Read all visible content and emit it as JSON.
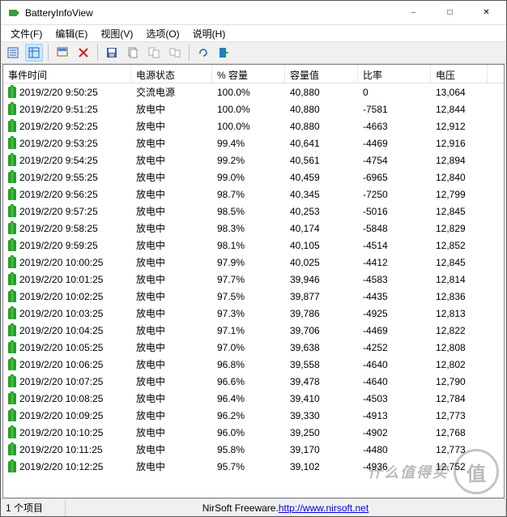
{
  "window": {
    "title": "BatteryInfoView"
  },
  "menu": {
    "file": "文件(F)",
    "edit": "编辑(E)",
    "view": "视图(V)",
    "options": "选项(O)",
    "help": "说明(H)"
  },
  "columns": {
    "time": "事件时间",
    "state": "电源状态",
    "pct": "% 容量",
    "cap": "容量值",
    "rate": "比率",
    "voltage": "电压"
  },
  "rows": [
    {
      "time": "2019/2/20 9:50:25",
      "state": "交流电源",
      "pct": "100.0%",
      "cap": "40,880",
      "rate": "0",
      "voltage": "13,064"
    },
    {
      "time": "2019/2/20 9:51:25",
      "state": "放电中",
      "pct": "100.0%",
      "cap": "40,880",
      "rate": "-7581",
      "voltage": "12,844"
    },
    {
      "time": "2019/2/20 9:52:25",
      "state": "放电中",
      "pct": "100.0%",
      "cap": "40,880",
      "rate": "-4663",
      "voltage": "12,912"
    },
    {
      "time": "2019/2/20 9:53:25",
      "state": "放电中",
      "pct": "99.4%",
      "cap": "40,641",
      "rate": "-4469",
      "voltage": "12,916"
    },
    {
      "time": "2019/2/20 9:54:25",
      "state": "放电中",
      "pct": "99.2%",
      "cap": "40,561",
      "rate": "-4754",
      "voltage": "12,894"
    },
    {
      "time": "2019/2/20 9:55:25",
      "state": "放电中",
      "pct": "99.0%",
      "cap": "40,459",
      "rate": "-6965",
      "voltage": "12,840"
    },
    {
      "time": "2019/2/20 9:56:25",
      "state": "放电中",
      "pct": "98.7%",
      "cap": "40,345",
      "rate": "-7250",
      "voltage": "12,799"
    },
    {
      "time": "2019/2/20 9:57:25",
      "state": "放电中",
      "pct": "98.5%",
      "cap": "40,253",
      "rate": "-5016",
      "voltage": "12,845"
    },
    {
      "time": "2019/2/20 9:58:25",
      "state": "放电中",
      "pct": "98.3%",
      "cap": "40,174",
      "rate": "-5848",
      "voltage": "12,829"
    },
    {
      "time": "2019/2/20 9:59:25",
      "state": "放电中",
      "pct": "98.1%",
      "cap": "40,105",
      "rate": "-4514",
      "voltage": "12,852"
    },
    {
      "time": "2019/2/20 10:00:25",
      "state": "放电中",
      "pct": "97.9%",
      "cap": "40,025",
      "rate": "-4412",
      "voltage": "12,845"
    },
    {
      "time": "2019/2/20 10:01:25",
      "state": "放电中",
      "pct": "97.7%",
      "cap": "39,946",
      "rate": "-4583",
      "voltage": "12,814"
    },
    {
      "time": "2019/2/20 10:02:25",
      "state": "放电中",
      "pct": "97.5%",
      "cap": "39,877",
      "rate": "-4435",
      "voltage": "12,836"
    },
    {
      "time": "2019/2/20 10:03:25",
      "state": "放电中",
      "pct": "97.3%",
      "cap": "39,786",
      "rate": "-4925",
      "voltage": "12,813"
    },
    {
      "time": "2019/2/20 10:04:25",
      "state": "放电中",
      "pct": "97.1%",
      "cap": "39,706",
      "rate": "-4469",
      "voltage": "12,822"
    },
    {
      "time": "2019/2/20 10:05:25",
      "state": "放电中",
      "pct": "97.0%",
      "cap": "39,638",
      "rate": "-4252",
      "voltage": "12,808"
    },
    {
      "time": "2019/2/20 10:06:25",
      "state": "放电中",
      "pct": "96.8%",
      "cap": "39,558",
      "rate": "-4640",
      "voltage": "12,802"
    },
    {
      "time": "2019/2/20 10:07:25",
      "state": "放电中",
      "pct": "96.6%",
      "cap": "39,478",
      "rate": "-4640",
      "voltage": "12,790"
    },
    {
      "time": "2019/2/20 10:08:25",
      "state": "放电中",
      "pct": "96.4%",
      "cap": "39,410",
      "rate": "-4503",
      "voltage": "12,784"
    },
    {
      "time": "2019/2/20 10:09:25",
      "state": "放电中",
      "pct": "96.2%",
      "cap": "39,330",
      "rate": "-4913",
      "voltage": "12,773"
    },
    {
      "time": "2019/2/20 10:10:25",
      "state": "放电中",
      "pct": "96.0%",
      "cap": "39,250",
      "rate": "-4902",
      "voltage": "12,768"
    },
    {
      "time": "2019/2/20 10:11:25",
      "state": "放电中",
      "pct": "95.8%",
      "cap": "39,170",
      "rate": "-4480",
      "voltage": "12,773"
    },
    {
      "time": "2019/2/20 10:12:25",
      "state": "放电中",
      "pct": "95.7%",
      "cap": "39,102",
      "rate": "-4936",
      "voltage": "12,752"
    }
  ],
  "status": {
    "count": "1 个项目",
    "credit_text": "NirSoft Freeware. ",
    "credit_url": "http://www.nirsoft.net"
  },
  "watermark": {
    "logo": "值",
    "text": "什么值得买"
  }
}
